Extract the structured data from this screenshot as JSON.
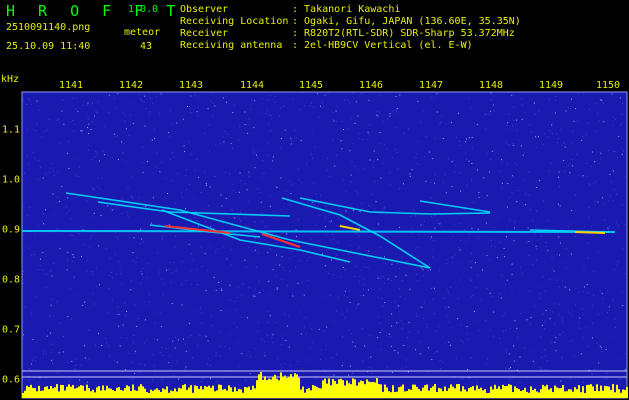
{
  "header": {
    "logo": "H R O F F T",
    "version": "1.0.0",
    "filename": "2510091140.png",
    "datetime": "25.10.09 11:40",
    "meteor_label": "meteor",
    "meteor_count": "43"
  },
  "info": [
    {
      "key": "Observer",
      "value": ": Takanori Kawachi"
    },
    {
      "key": "Receiving Location",
      "value": ": Ogaki, Gifu, JAPAN (136.60E, 35.35N)"
    },
    {
      "key": "Receiver",
      "value": ": R820T2(RTL-SDR) SDR-Sharp 53.372MHz"
    },
    {
      "key": "Receiving antenna",
      "value": ": 2el-HB9CV Vertical (el. E-W)"
    }
  ],
  "spectrogram": {
    "y_unit": "kHz",
    "time_ticks": [
      "1141",
      "1142",
      "1143",
      "1144",
      "1145",
      "1146",
      "1147",
      "1148",
      "1149",
      "1150"
    ],
    "freq_ticks": [
      "1.1",
      "1.0",
      "0.9",
      "0.8",
      "0.7",
      "0.6"
    ],
    "background_color": "#1a1ab0",
    "trail_color": "#00e0ff",
    "histogram_color": "#ffff00"
  }
}
